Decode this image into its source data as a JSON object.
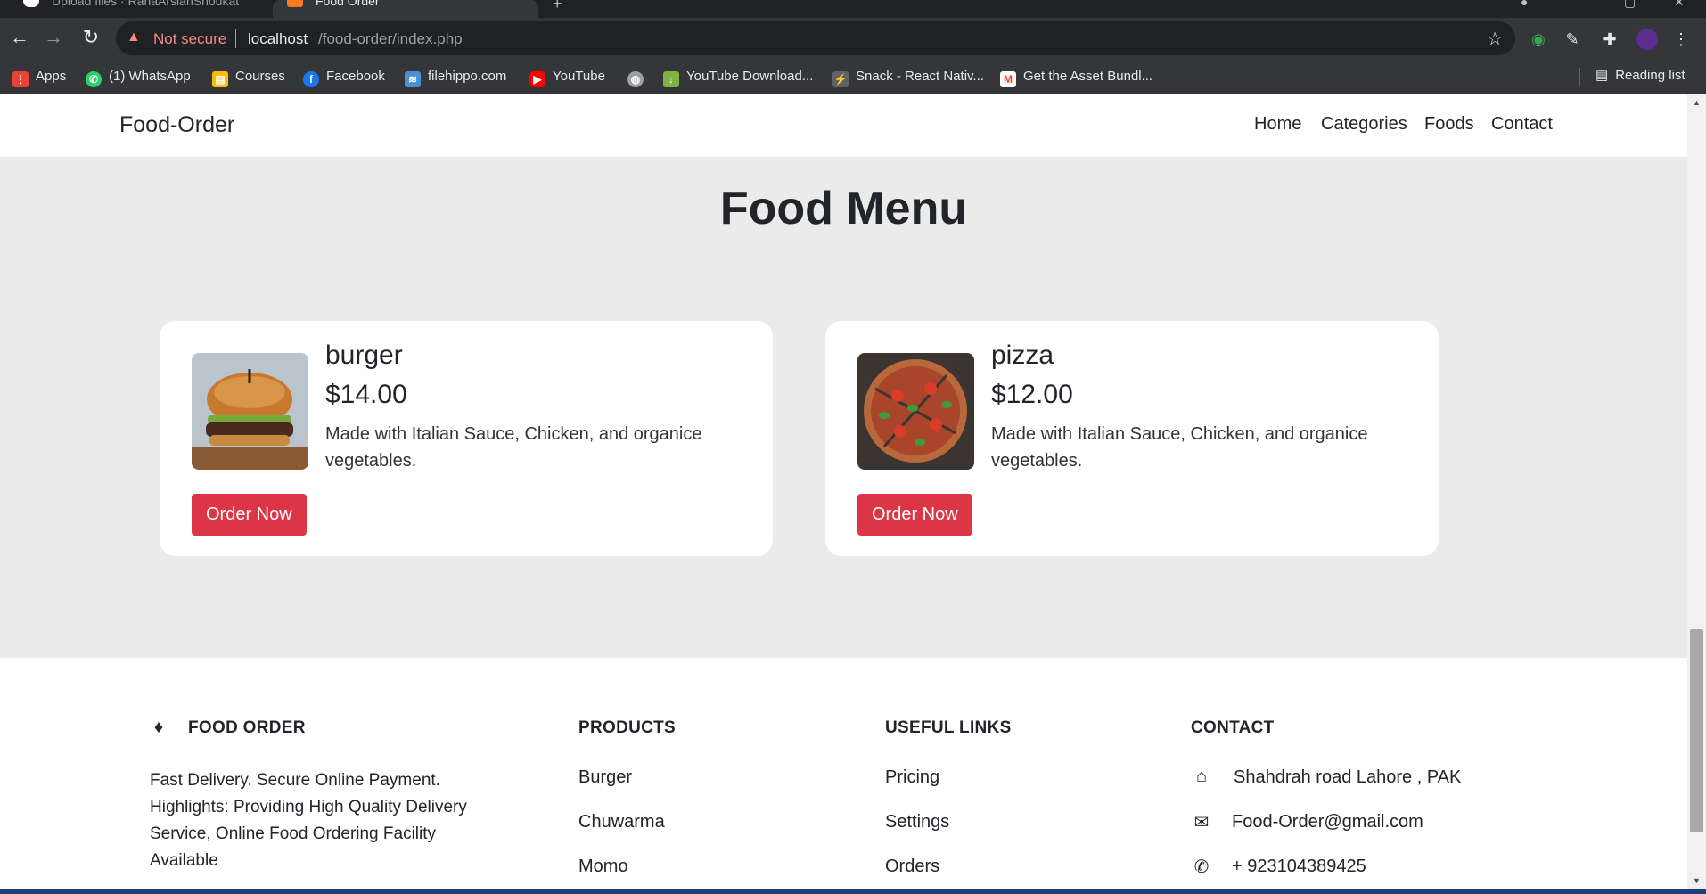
{
  "browser": {
    "tabs": [
      {
        "title": "Upload files · RanaArslanShoukat",
        "active": false
      },
      {
        "title": "Food Order",
        "active": true
      }
    ],
    "security_label": "Not secure",
    "url_host": "localhost",
    "url_path": "/food-order/index.php",
    "bookmarks": [
      {
        "label": "Apps",
        "icon": "apps-grid-icon",
        "color": "#ea4335"
      },
      {
        "label": "(1) WhatsApp",
        "icon": "whatsapp-icon",
        "color": "#25d366"
      },
      {
        "label": "Courses",
        "icon": "courses-icon",
        "color": "#fbbc04"
      },
      {
        "label": "Facebook",
        "icon": "facebook-icon",
        "color": "#1877f2"
      },
      {
        "label": "filehippo.com",
        "icon": "filehippo-icon",
        "color": "#4a90d9"
      },
      {
        "label": "YouTube",
        "icon": "youtube-icon",
        "color": "#ff0000"
      },
      {
        "label": "",
        "icon": "globe-icon",
        "color": "#9aa0a6"
      },
      {
        "label": "YouTube Download...",
        "icon": "download-icon",
        "color": "#7cb342"
      },
      {
        "label": "Snack - React Nativ...",
        "icon": "snack-icon",
        "color": "#e8eaed"
      },
      {
        "label": "Get the Asset Bundl...",
        "icon": "gmail-icon",
        "color": "#ea4335"
      }
    ],
    "reading_list": "Reading list"
  },
  "site": {
    "brand": "Food-Order",
    "nav": [
      "Home",
      "Categories",
      "Foods",
      "Contact"
    ],
    "menu_title": "Food Menu",
    "foods": [
      {
        "name": "burger",
        "price": "$14.00",
        "description": "Made with Italian Sauce, Chicken, and organice vegetables.",
        "button": "Order Now"
      },
      {
        "name": "pizza",
        "price": "$12.00",
        "description": "Made with Italian Sauce, Chicken, and organice vegetables.",
        "button": "Order Now"
      }
    ],
    "accent_color": "#dc3545"
  },
  "footer": {
    "brand": "FOOD ORDER",
    "about": "Fast Delivery. Secure Online Payment. Highlights: Providing High Quality Delivery Service, Online Food Ordering Facility Available",
    "products_title": "PRODUCTS",
    "products": [
      "Burger",
      "Chuwarma",
      "Momo"
    ],
    "links_title": "USEFUL LINKS",
    "links": [
      "Pricing",
      "Settings",
      "Orders"
    ],
    "contact_title": "CONTACT",
    "address": "Shahdrah road Lahore , PAK",
    "email": "Food-Order@gmail.com",
    "phone": "+ 923104389425"
  }
}
